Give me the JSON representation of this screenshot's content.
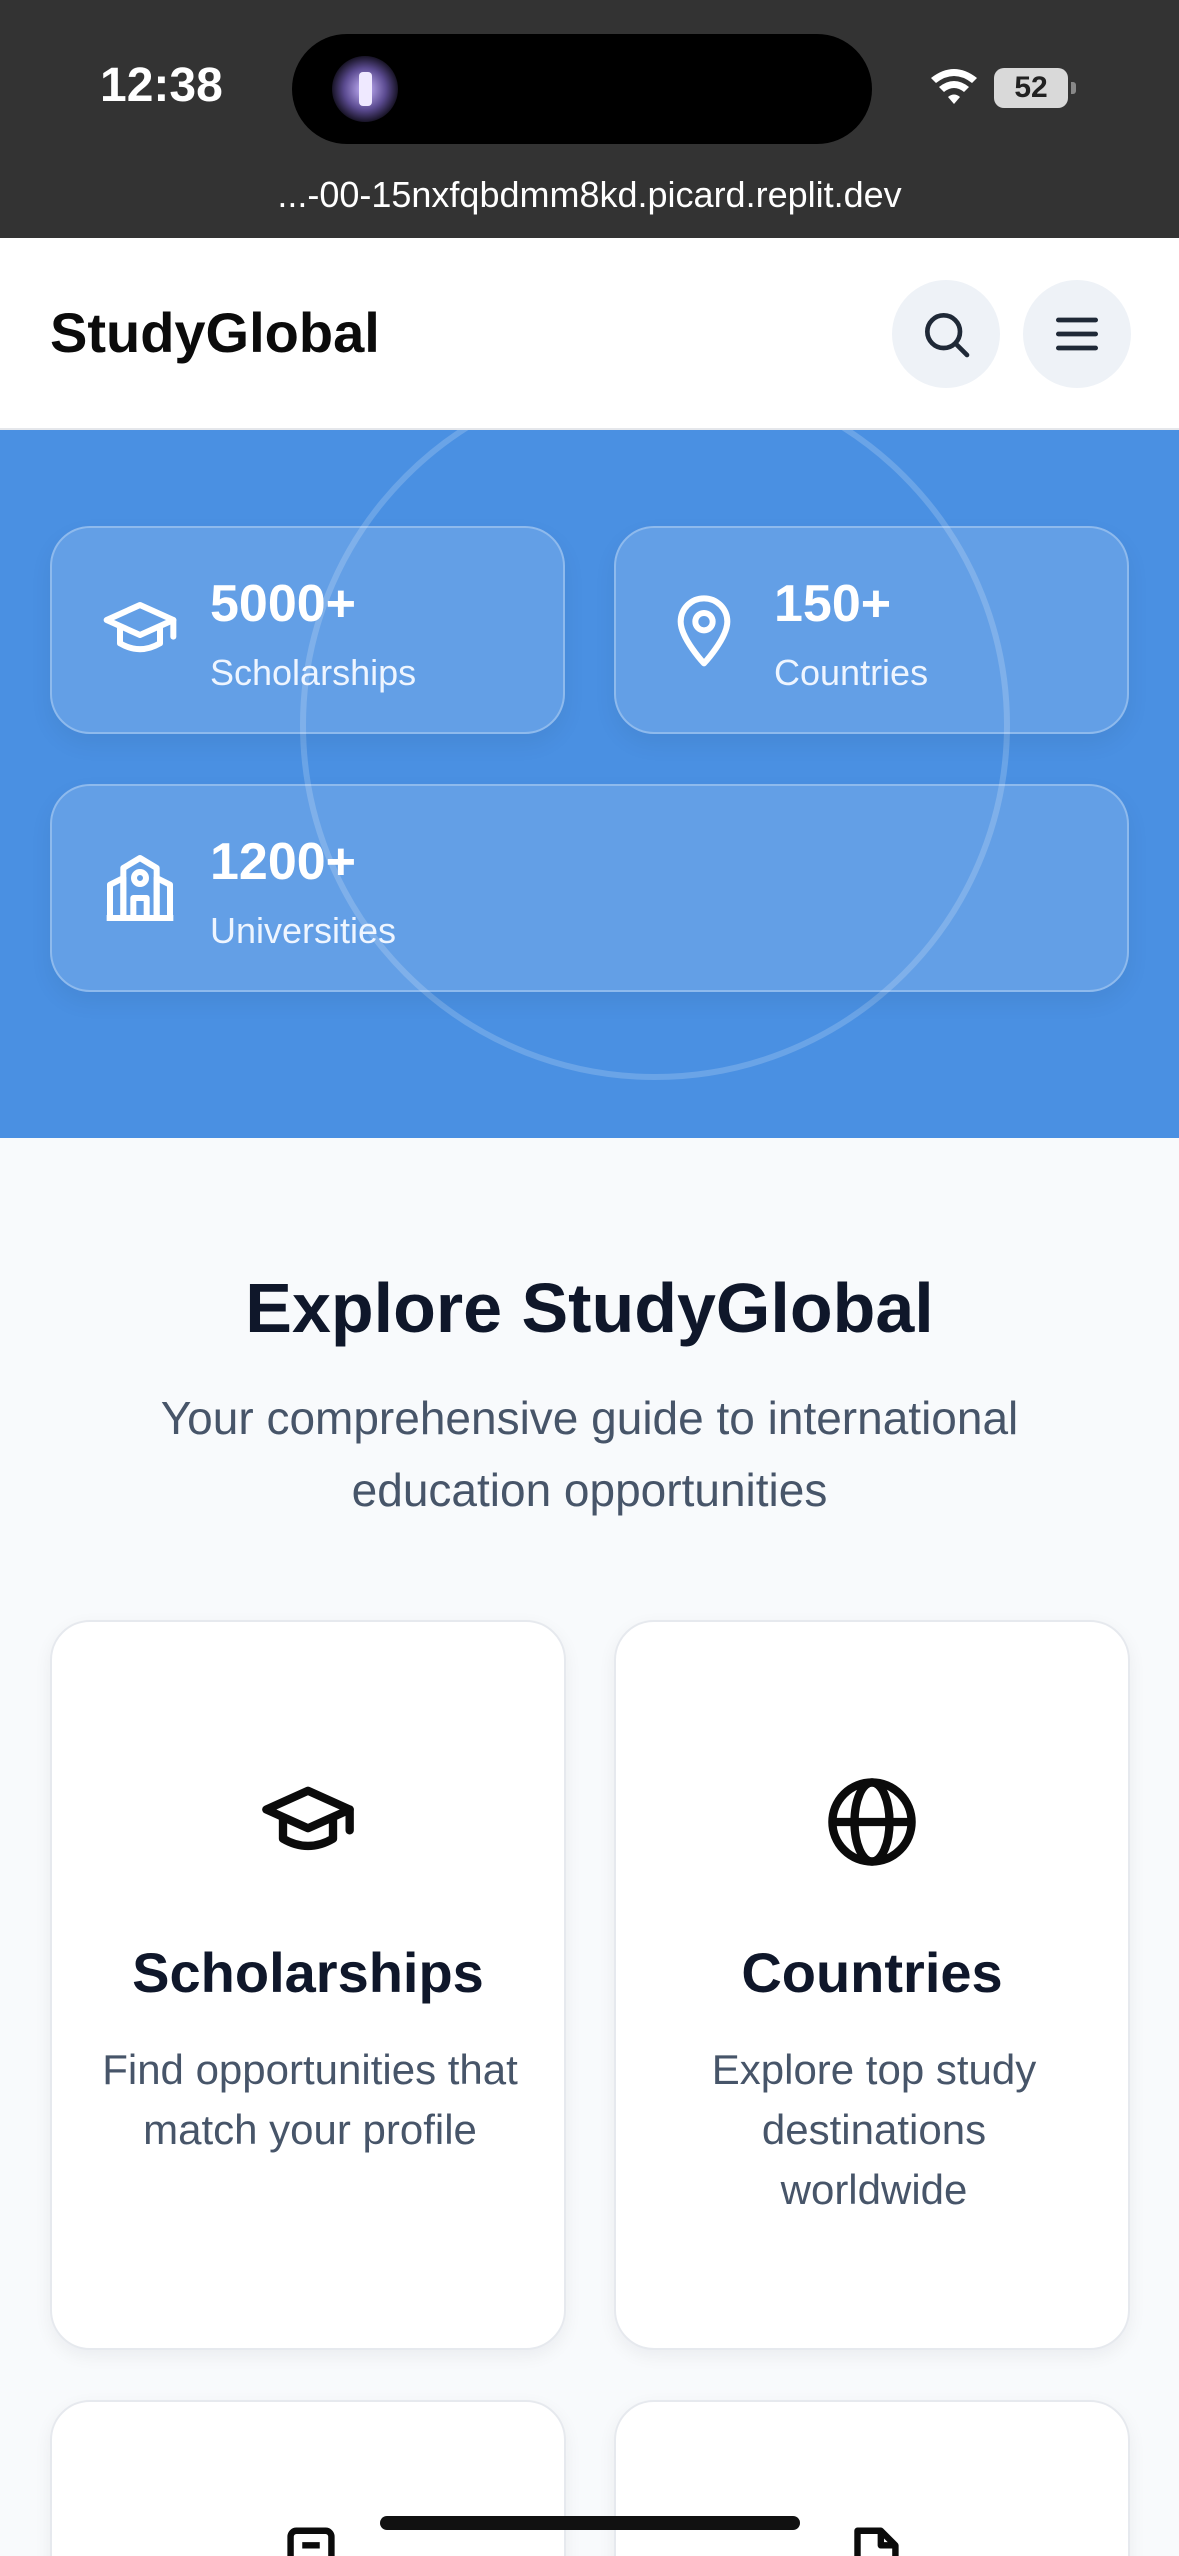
{
  "status_bar": {
    "time": "12:38",
    "battery": "52"
  },
  "browser": {
    "url": "...-00-15nxfqbdmm8kd.picard.replit.dev"
  },
  "header": {
    "brand": "StudyGlobal",
    "search_icon": "search-icon",
    "menu_icon": "menu-icon"
  },
  "hero": {
    "background": "#4a90e2",
    "stats": [
      {
        "value": "5000+",
        "label": "Scholarships",
        "icon": "graduation-cap-icon"
      },
      {
        "value": "150+",
        "label": "Countries",
        "icon": "location-pin-icon"
      },
      {
        "value": "1200+",
        "label": "Universities",
        "icon": "school-building-icon"
      }
    ]
  },
  "explore": {
    "title": "Explore StudyGlobal",
    "subtitle": "Your comprehensive guide to international education opportunities",
    "cards": [
      {
        "title": "Scholarships",
        "description": "Find opportunities that match your profile",
        "icon": "graduation-cap-icon"
      },
      {
        "title": "Countries",
        "description": "Explore top study destinations worldwide",
        "icon": "globe-icon"
      }
    ]
  }
}
